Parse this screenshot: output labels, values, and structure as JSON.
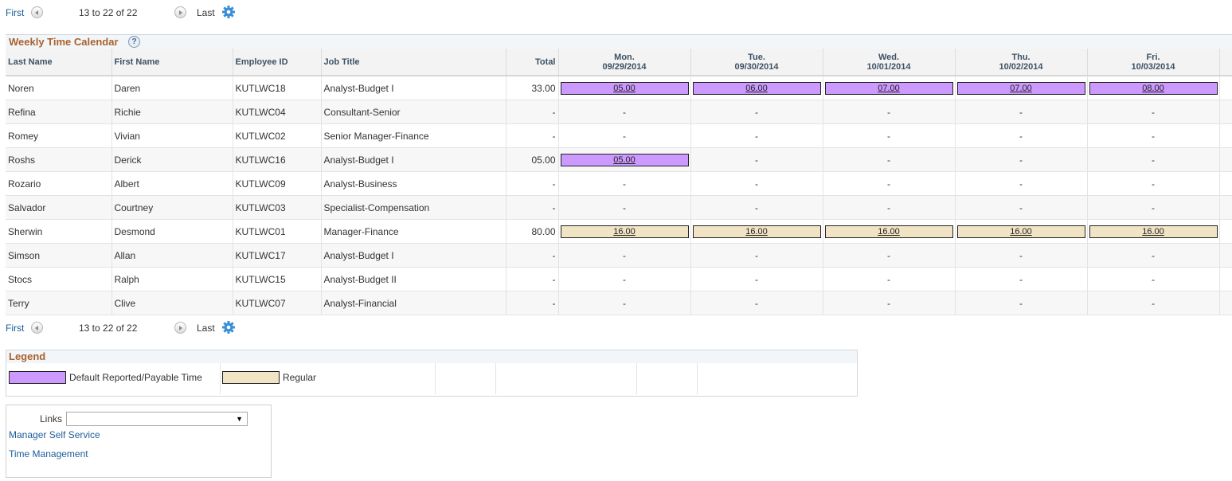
{
  "nav": {
    "first": "First",
    "range": "13 to 22 of 22",
    "last": "Last"
  },
  "grid": {
    "title": "Weekly Time Calendar",
    "help": "?",
    "columns": {
      "last_name": "Last Name",
      "first_name": "First Name",
      "employee_id": "Employee ID",
      "job_title": "Job Title",
      "total": "Total"
    },
    "days": [
      {
        "name": "Mon.",
        "date": "09/29/2014"
      },
      {
        "name": "Tue.",
        "date": "09/30/2014"
      },
      {
        "name": "Wed.",
        "date": "10/01/2014"
      },
      {
        "name": "Thu.",
        "date": "10/02/2014"
      },
      {
        "name": "Fri.",
        "date": "10/03/2014"
      }
    ],
    "rows": [
      {
        "last": "Noren",
        "first": "Daren",
        "id": "KUTLWC18",
        "job": "Analyst-Budget I",
        "total": "33.00",
        "days": [
          {
            "v": "05.00",
            "t": "default"
          },
          {
            "v": "06.00",
            "t": "default"
          },
          {
            "v": "07.00",
            "t": "default"
          },
          {
            "v": "07.00",
            "t": "default"
          },
          {
            "v": "08.00",
            "t": "default"
          }
        ]
      },
      {
        "last": "Refina",
        "first": "Richie",
        "id": "KUTLWC04",
        "job": "Consultant-Senior",
        "total": "-",
        "days": [
          {
            "v": "-"
          },
          {
            "v": "-"
          },
          {
            "v": "-"
          },
          {
            "v": "-"
          },
          {
            "v": "-"
          }
        ]
      },
      {
        "last": "Romey",
        "first": "Vivian",
        "id": "KUTLWC02",
        "job": "Senior Manager-Finance",
        "total": "-",
        "days": [
          {
            "v": "-"
          },
          {
            "v": "-"
          },
          {
            "v": "-"
          },
          {
            "v": "-"
          },
          {
            "v": "-"
          }
        ]
      },
      {
        "last": "Roshs",
        "first": "Derick",
        "id": "KUTLWC16",
        "job": "Analyst-Budget I",
        "total": "05.00",
        "days": [
          {
            "v": "05.00",
            "t": "default"
          },
          {
            "v": "-"
          },
          {
            "v": "-"
          },
          {
            "v": "-"
          },
          {
            "v": "-"
          }
        ]
      },
      {
        "last": "Rozario",
        "first": "Albert",
        "id": "KUTLWC09",
        "job": "Analyst-Business",
        "total": "-",
        "days": [
          {
            "v": "-"
          },
          {
            "v": "-"
          },
          {
            "v": "-"
          },
          {
            "v": "-"
          },
          {
            "v": "-"
          }
        ]
      },
      {
        "last": "Salvador",
        "first": "Courtney",
        "id": "KUTLWC03",
        "job": "Specialist-Compensation",
        "total": "-",
        "days": [
          {
            "v": "-"
          },
          {
            "v": "-"
          },
          {
            "v": "-"
          },
          {
            "v": "-"
          },
          {
            "v": "-"
          }
        ]
      },
      {
        "last": "Sherwin",
        "first": "Desmond",
        "id": "KUTLWC01",
        "job": "Manager-Finance",
        "total": "80.00",
        "days": [
          {
            "v": "16.00",
            "t": "regular"
          },
          {
            "v": "16.00",
            "t": "regular"
          },
          {
            "v": "16.00",
            "t": "regular"
          },
          {
            "v": "16.00",
            "t": "regular"
          },
          {
            "v": "16.00",
            "t": "regular"
          }
        ]
      },
      {
        "last": "Simson",
        "first": "Allan",
        "id": "KUTLWC17",
        "job": "Analyst-Budget I",
        "total": "-",
        "days": [
          {
            "v": "-"
          },
          {
            "v": "-"
          },
          {
            "v": "-"
          },
          {
            "v": "-"
          },
          {
            "v": "-"
          }
        ]
      },
      {
        "last": "Stocs",
        "first": "Ralph",
        "id": "KUTLWC15",
        "job": "Analyst-Budget II",
        "total": "-",
        "days": [
          {
            "v": "-"
          },
          {
            "v": "-"
          },
          {
            "v": "-"
          },
          {
            "v": "-"
          },
          {
            "v": "-"
          }
        ]
      },
      {
        "last": "Terry",
        "first": "Clive",
        "id": "KUTLWC07",
        "job": "Analyst-Financial",
        "total": "-",
        "days": [
          {
            "v": "-"
          },
          {
            "v": "-"
          },
          {
            "v": "-"
          },
          {
            "v": "-"
          },
          {
            "v": "-"
          }
        ]
      }
    ]
  },
  "legend": {
    "title": "Legend",
    "items": [
      {
        "label": "Default Reported/Payable Time",
        "color": "#cc99ff"
      },
      {
        "label": "Regular",
        "color": "#f1e4c4"
      }
    ]
  },
  "links": {
    "label": "Links",
    "selected": "",
    "items": [
      "Manager Self Service",
      "Time Management"
    ]
  },
  "colors": {
    "title": "#a8612d",
    "link": "#1c5d99",
    "default_time": "#cc99ff",
    "regular_time": "#f1e4c4"
  }
}
